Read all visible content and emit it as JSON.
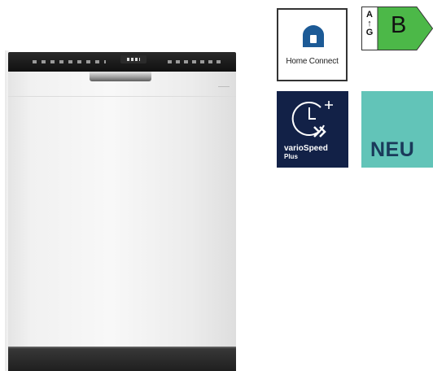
{
  "product": {
    "image_icon": "dishwasher-icon"
  },
  "badges": {
    "home_connect": {
      "label": "Home Connect",
      "icon": "home-connect-house-icon",
      "color": "#1c5a96"
    },
    "energy_label": {
      "scale_top": "A",
      "scale_bottom": "G",
      "energy_class": "B",
      "color": "#4cb848"
    },
    "vario_speed": {
      "title": "varioSpeed",
      "subtitle": "Plus",
      "icon": "clock-fast-forward-icon",
      "background": "#122147"
    },
    "new_badge": {
      "label": "NEU",
      "background": "#62c4b8",
      "text_color": "#1a3a5a"
    }
  }
}
